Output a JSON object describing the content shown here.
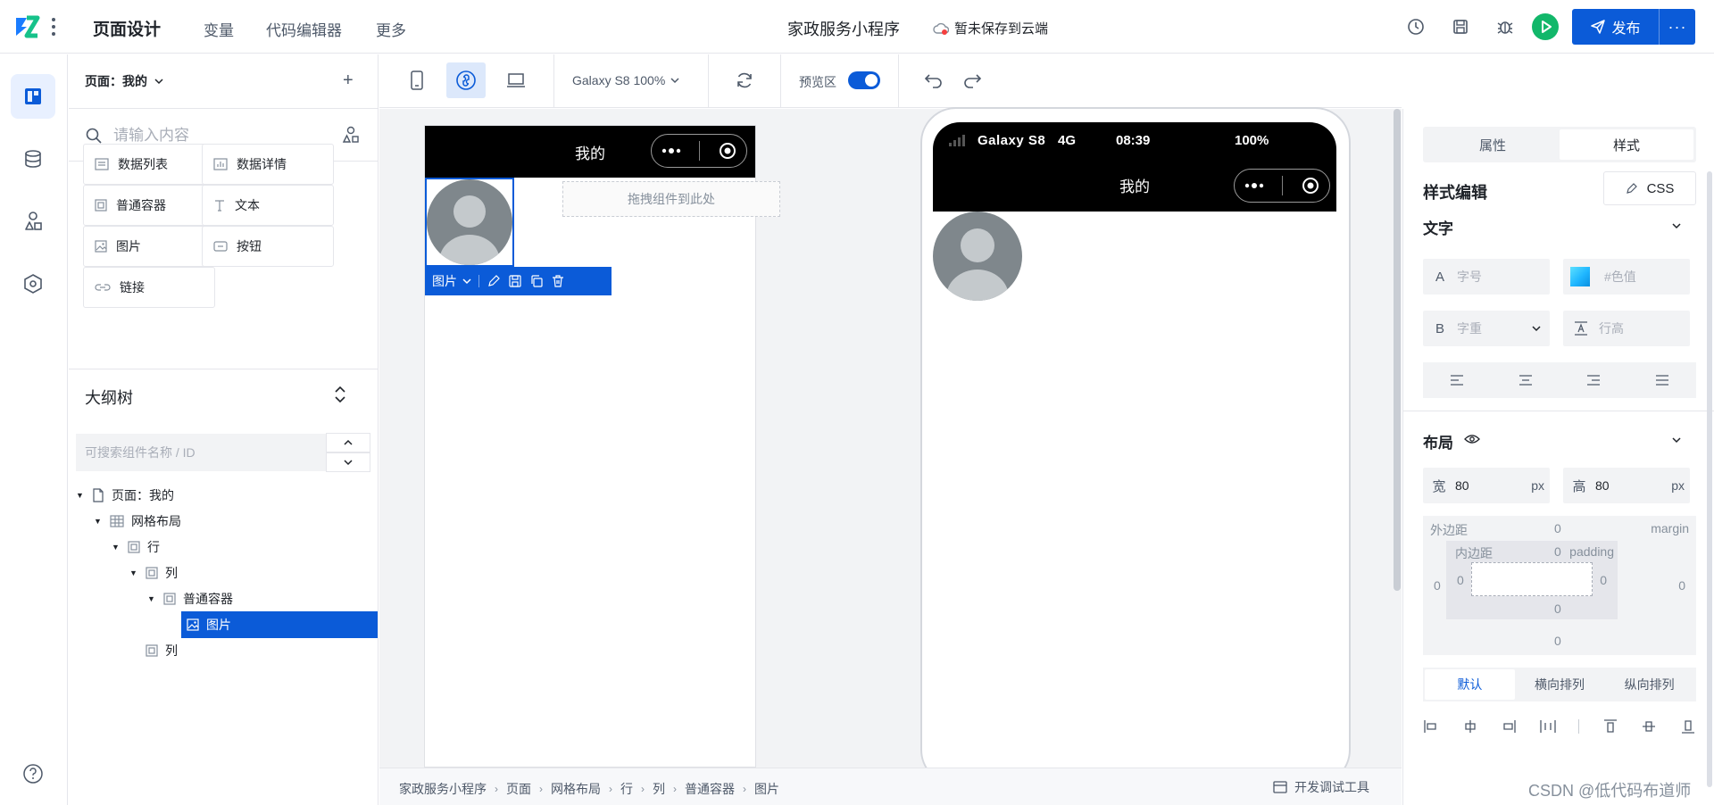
{
  "topbar": {
    "title": "页面设计",
    "nav": [
      "变量",
      "代码编辑器",
      "更多"
    ],
    "app_name": "家政服务小程序",
    "save_status": "暂未保存到云端",
    "publish_label": "发布",
    "more_label": "···"
  },
  "component_panel": {
    "page_select": "页面：我的",
    "add": "+",
    "search_placeholder": "请输入内容",
    "components": [
      {
        "label": "数据列表",
        "icon": "data-list-icon"
      },
      {
        "label": "数据详情",
        "icon": "data-detail-icon"
      },
      {
        "label": "普通容器",
        "icon": "container-icon"
      },
      {
        "label": "文本",
        "icon": "text-icon"
      },
      {
        "label": "图片",
        "icon": "image-icon"
      },
      {
        "label": "按钮",
        "icon": "button-icon"
      },
      {
        "label": "链接",
        "icon": "link-icon"
      }
    ]
  },
  "outline": {
    "title": "大纲树",
    "search_placeholder": "可搜索组件名称 / ID",
    "nodes": [
      {
        "label": "页面：我的",
        "icon": "page-icon",
        "depth": 0,
        "caret": true,
        "selected": false
      },
      {
        "label": "网格布局",
        "icon": "grid-icon",
        "depth": 1,
        "caret": true,
        "selected": false
      },
      {
        "label": "行",
        "icon": "container-icon",
        "depth": 2,
        "caret": true,
        "selected": false
      },
      {
        "label": "列",
        "icon": "container-icon",
        "depth": 3,
        "caret": true,
        "selected": false
      },
      {
        "label": "普通容器",
        "icon": "container-icon",
        "depth": 4,
        "caret": true,
        "selected": false
      },
      {
        "label": "图片",
        "icon": "image-icon",
        "depth": 5,
        "caret": false,
        "selected": true
      },
      {
        "label": "列",
        "icon": "container-icon",
        "depth": 3,
        "caret": false,
        "selected": false
      }
    ]
  },
  "toolbar": {
    "device_select": "Galaxy S8 100%",
    "preview_label": "预览区",
    "preview_on": true
  },
  "editor": {
    "page_title": "我的",
    "drop_hint": "拖拽组件到此处",
    "selection_label": "图片"
  },
  "preview": {
    "device": "Galaxy S8",
    "network": "4G",
    "time": "08:39",
    "battery": "100%",
    "page_title": "我的"
  },
  "breadcrumb": {
    "items": [
      "家政服务小程序",
      "页面",
      "网格布局",
      "行",
      "列",
      "普通容器",
      "图片"
    ],
    "dev_tools": "开发调试工具"
  },
  "style_panel": {
    "tabs": [
      "属性",
      "样式"
    ],
    "active_tab": "样式",
    "editor_title": "样式编辑",
    "css_button": "CSS",
    "text_section": "文字",
    "font_size_label": "A",
    "font_size_placeholder": "字号",
    "color_placeholder": "#色值",
    "color_swatch": "#1fb6ff",
    "font_weight_label": "B",
    "font_weight_placeholder": "字重",
    "line_height_placeholder": "行高",
    "layout_section": "布局",
    "width_label": "宽",
    "width_value": "80",
    "height_label": "高",
    "height_value": "80",
    "unit": "px",
    "margin_label": "外边距",
    "margin_key": "margin",
    "padding_label": "内边距",
    "padding_key": "padding",
    "margin_top": "0",
    "margin_right": "0",
    "margin_bottom": "0",
    "margin_left": "0",
    "padding_top": "0",
    "padding_right": "0",
    "padding_bottom": "0",
    "padding_left": "0",
    "layout_modes": [
      "默认",
      "横向排列",
      "纵向排列"
    ],
    "active_layout_mode": "默认"
  },
  "watermark": "CSDN @低代码布道师",
  "colors": {
    "accent": "#0b5bd8",
    "run": "#12b76a",
    "avatar_bg": "#7f878c",
    "avatar_fg": "#c4c9cc"
  }
}
